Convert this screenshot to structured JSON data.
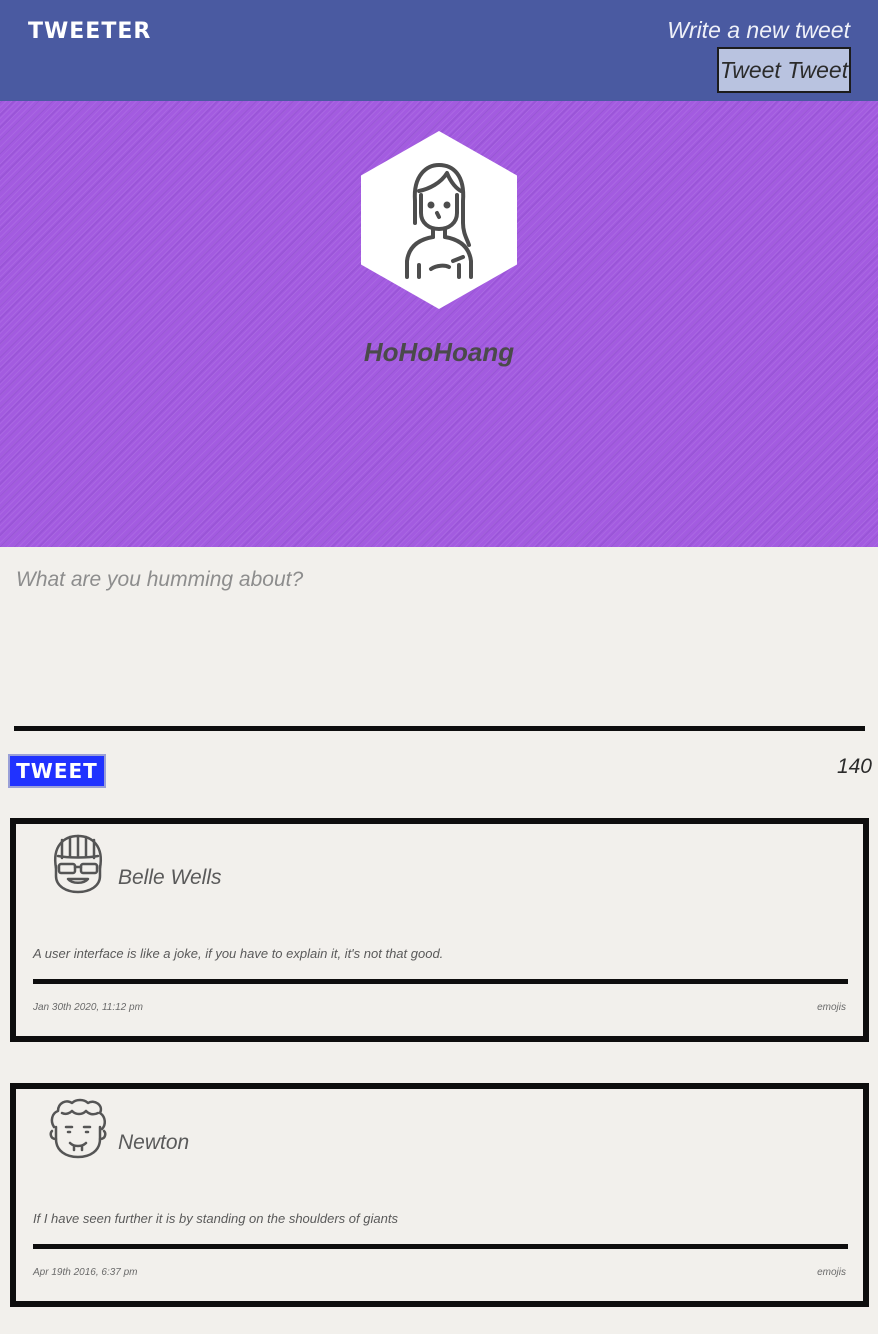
{
  "nav": {
    "brand": "TWEETER",
    "compose_label": "Write a new tweet",
    "compose_button": "Tweet Tweet",
    "background_color": "#4a5aa1"
  },
  "profile": {
    "username": "HoHoHoang",
    "avatar_icon": "girl-avatar-icon",
    "header_color": "#a35be0"
  },
  "compose": {
    "placeholder": "What are you humming about?",
    "tweet_button": "TWEET",
    "tweet_button_color": "#2032ff",
    "char_count": "140"
  },
  "tweets": [
    {
      "author": "Belle Wells",
      "avatar_icon": "sunglasses-face-icon",
      "content": "A user interface is like a joke, if you have to explain it, it's not that good.",
      "timestamp": "Jan 30th 2020, 11:12 pm",
      "action": "emojis"
    },
    {
      "author": "Newton",
      "avatar_icon": "curly-hair-face-icon",
      "content": "If I have seen further it is by standing on the shoulders of giants",
      "timestamp": "Apr 19th 2016, 6:37 pm",
      "action": "emojis"
    }
  ]
}
